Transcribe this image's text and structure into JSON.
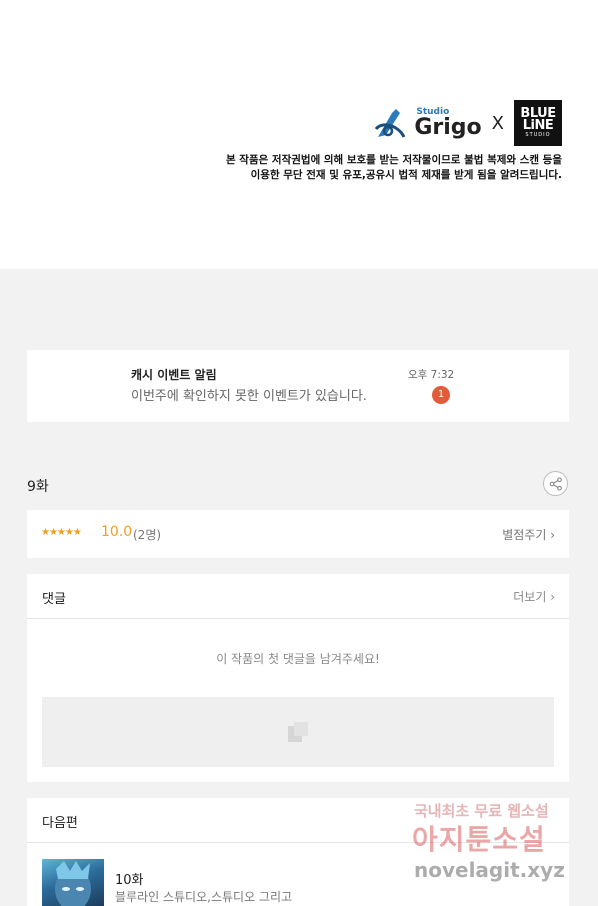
{
  "banner": {
    "studio_small": "Studio",
    "studio_name": "Grigo",
    "x": "X",
    "blueline_top": "BLUE",
    "blueline_bottom": "LiNE",
    "blueline_small": "STUDIO",
    "notice_line1": "본 작품은 저작권법에 의해 보호를 받는 저작물이므로 불법 복제와 스캔 등을",
    "notice_line2": "이용한 무단 전재 및 유포,공유시 법적 제재를 받게 됨을 알려드립니다."
  },
  "event": {
    "title": "캐시 이벤트 알림",
    "body": "이번주에 확인하지 못한 이벤트가 있습니다.",
    "time": "오후 7:32",
    "badge": "1"
  },
  "episode": {
    "title": "9화",
    "share_icon": "share-icon"
  },
  "rating": {
    "stars": "★★★★★",
    "score": "10.0",
    "count": "(2명)",
    "rate_label": "별점주기 ›"
  },
  "comments": {
    "title": "댓글",
    "more_label": "더보기 ›",
    "empty_message": "이 작품의 첫 댓글을 남겨주세요!"
  },
  "next": {
    "title": "다음편",
    "episode": "10화",
    "author": "블루라인 스튜디오,스튜디오 그리고"
  },
  "watermark": {
    "line1": "국내최초 무료 웹소설",
    "line2": "아지툰소설",
    "line3": "novelagit.xyz"
  },
  "colors": {
    "accent_star": "#f0a020",
    "badge": "#e25b3a",
    "brand_blue": "#2a7bbd"
  }
}
